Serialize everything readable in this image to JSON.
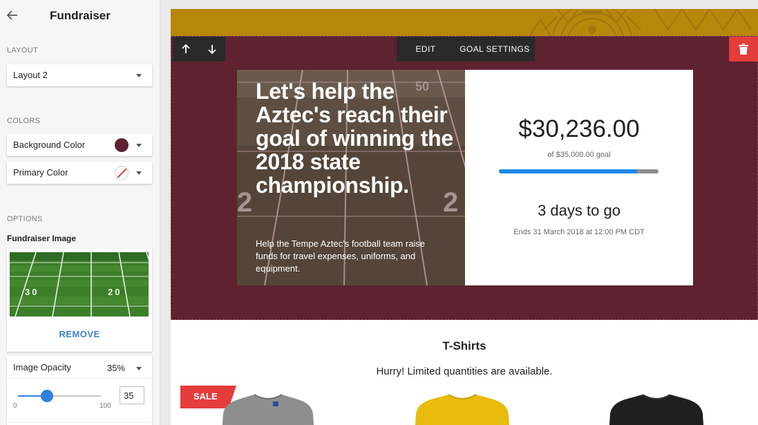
{
  "sidebar": {
    "title": "Fundraiser",
    "layout_label": "LAYOUT",
    "layout_value": "Layout 2",
    "colors_label": "COLORS",
    "background_color_label": "Background Color",
    "background_color": "#5e2230",
    "primary_color_label": "Primary Color",
    "options_label": "OPTIONS",
    "image_label": "Fundraiser Image",
    "remove_label": "REMOVE",
    "opacity_label": "Image Opacity",
    "opacity_display": "35%",
    "opacity_value": 35,
    "opacity_min": "0",
    "opacity_max": "100"
  },
  "toolbar": {
    "edit_label": "EDIT",
    "goal_settings_label": "GOAL SETTINGS"
  },
  "hero": {
    "headline": "Let's help the Aztec's reach their goal of winning the 2018 state championship.",
    "description": "Help the Tempe Aztec's football team raise funds for travel expenses, uniforms, and equipment.",
    "background_color": "#5e2230"
  },
  "goal": {
    "raised": "$30,236.00",
    "goal_text": "of $35,000.00 goal",
    "progress_fraction": 0.864,
    "days_left": "3 days to go",
    "ends": "Ends 31 March 2018 at 12:00 PM CDT"
  },
  "products": {
    "title": "T-Shirts",
    "subtitle": "Hurry! Limited quantities are available.",
    "sale_badge": "SALE",
    "items": [
      {
        "color": "#8e8e8e"
      },
      {
        "color": "#e8bb0c"
      },
      {
        "color": "#1f1f1f"
      }
    ]
  },
  "colors": {
    "accent": "#2f7fe0",
    "delete": "#e53c3c",
    "top_band": "#b7860b"
  }
}
